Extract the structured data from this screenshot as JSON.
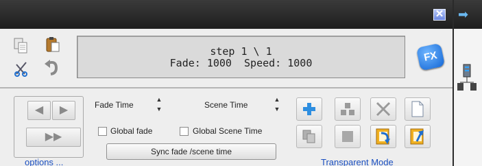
{
  "window": {
    "close_glyph": "✕",
    "export_glyph": "➡"
  },
  "display": {
    "step_line": "step 1 \\ 1",
    "status_line": "Fade: 1000  Speed: 1000"
  },
  "fx_button": {
    "label": "FX"
  },
  "timing": {
    "fade_time_label": "Fade Time",
    "scene_time_label": "Scene Time",
    "global_fade_label": "Global fade",
    "global_scene_time_label": "Global Scene Time",
    "global_fade_checked": false,
    "global_scene_time_checked": false,
    "sync_button_label": "Sync fade /scene time"
  },
  "nav": {
    "prev_glyph": "◀",
    "next_glyph": "▶",
    "fast_forward_glyph": "▶▶",
    "options_label": "options ..."
  },
  "tools": {
    "icons": [
      "add-step-icon",
      "group-icon",
      "delete-icon",
      "new-file-icon",
      "copy-step-icon",
      "stop-icon",
      "import-icon",
      "export-icon"
    ],
    "transparent_mode_label": "Transparent Mode"
  },
  "colors": {
    "accent_blue": "#1a4fc0",
    "titlebar": "#2a2a2a",
    "panel_bg": "#eeeeee",
    "fx_blue": "#1467d6"
  }
}
